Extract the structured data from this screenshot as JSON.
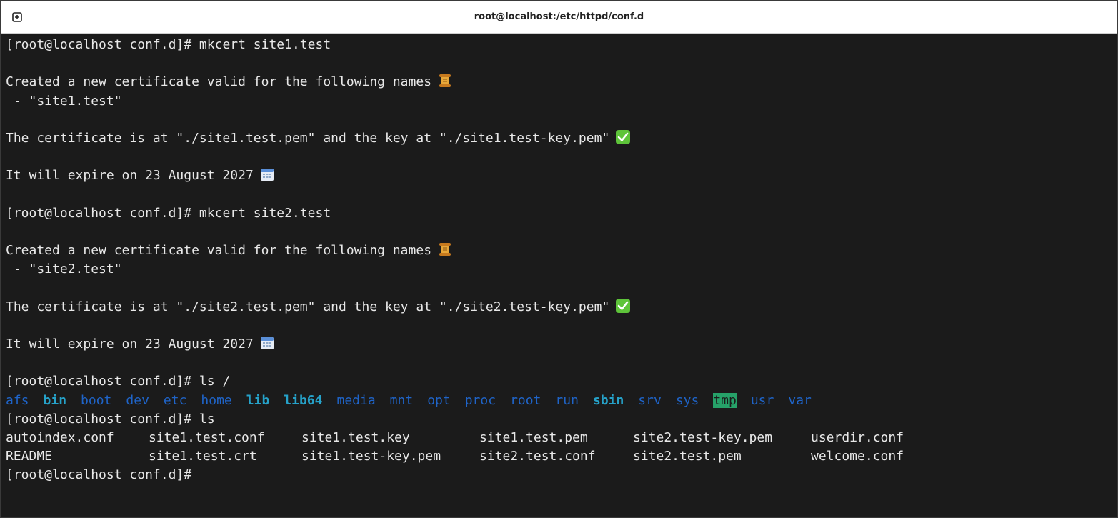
{
  "window": {
    "title": "root@localhost:/etc/httpd/conf.d",
    "tab_icon": "new-tab-icon"
  },
  "terminal": {
    "prompt": "[root@localhost conf.d]#",
    "cmd1": " mkcert site1.test",
    "created1": "Created a new certificate valid for the following names",
    "name1": " - \"site1.test\"",
    "cert1": "The certificate is at \"./site1.test.pem\" and the key at \"./site1.test-key.pem\"",
    "expire1": "It will expire on 23 August 2027",
    "cmd2": " mkcert site2.test",
    "created2": "Created a new certificate valid for the following names",
    "name2": " - \"site2.test\"",
    "cert2": "The certificate is at \"./site2.test.pem\" and the key at \"./site2.test-key.pem\"",
    "expire2": "It will expire on 23 August 2027",
    "cmd3": " ls /",
    "root_dirs": [
      {
        "name": "afs",
        "style": "plain"
      },
      {
        "name": "bin",
        "style": "bold"
      },
      {
        "name": "boot",
        "style": "plain"
      },
      {
        "name": "dev",
        "style": "plain"
      },
      {
        "name": "etc",
        "style": "plain"
      },
      {
        "name": "home",
        "style": "plain"
      },
      {
        "name": "lib",
        "style": "bold"
      },
      {
        "name": "lib64",
        "style": "bold"
      },
      {
        "name": "media",
        "style": "plain"
      },
      {
        "name": "mnt",
        "style": "plain"
      },
      {
        "name": "opt",
        "style": "plain"
      },
      {
        "name": "proc",
        "style": "plain"
      },
      {
        "name": "root",
        "style": "plain"
      },
      {
        "name": "run",
        "style": "plain"
      },
      {
        "name": "sbin",
        "style": "bold"
      },
      {
        "name": "srv",
        "style": "plain"
      },
      {
        "name": "sys",
        "style": "plain"
      },
      {
        "name": "tmp",
        "style": "highlight"
      },
      {
        "name": "usr",
        "style": "plain"
      },
      {
        "name": "var",
        "style": "plain"
      }
    ],
    "cmd4": " ls",
    "files_row1": [
      "autoindex.conf",
      "site1.test.conf",
      "site1.test.key",
      "site1.test.pem",
      "site2.test-key.pem",
      "userdir.conf"
    ],
    "files_row2": [
      "README",
      "site1.test.crt",
      "site1.test-key.pem",
      "site2.test.conf",
      "site2.test.pem",
      "welcome.conf"
    ],
    "colors": {
      "background": "#1b1b1b",
      "text": "#e8e8e8",
      "dir_bold": "#26a2c9",
      "dir_plain": "#1f64c8",
      "tmp_highlight": "#26a269"
    },
    "icons": {
      "names": "scroll-icon",
      "path": "check-mark-icon",
      "expire": "calendar-icon"
    }
  }
}
